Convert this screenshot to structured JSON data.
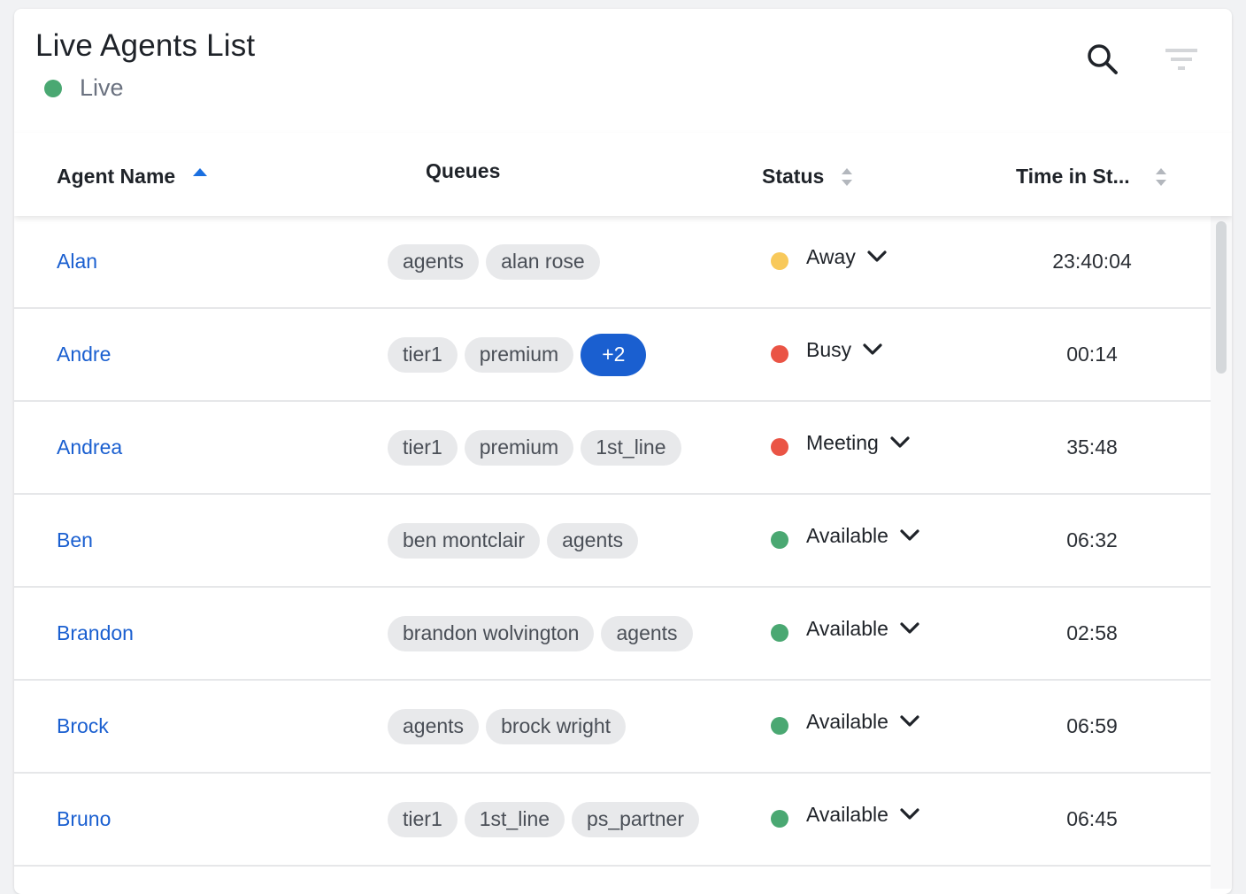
{
  "header": {
    "title": "Live Agents List",
    "live_label": "Live",
    "live_color": "#4aa872",
    "search_icon": "search-icon",
    "filter_icon": "filter-icon"
  },
  "columns": [
    {
      "label": "Agent Name",
      "sort": "ascending"
    },
    {
      "label": "Queues",
      "sort": "none"
    },
    {
      "label": "Status",
      "sort": "unsorted"
    },
    {
      "label": "Time in St...",
      "sort": "unsorted"
    }
  ],
  "colors": {
    "link": "#1a5fd0",
    "sort_active": "#1a6fe0",
    "sort_inactive": "#b3b7bd",
    "away": "#f8c95b",
    "busy": "#ea5445",
    "available": "#4aa872"
  },
  "rows": [
    {
      "name": "Alan",
      "queues": [
        "agents",
        "alan rose"
      ],
      "more": "",
      "status": "Away",
      "status_color": "#f8c95b",
      "time": "23:40:04"
    },
    {
      "name": "Andre",
      "queues": [
        "tier1",
        "premium"
      ],
      "more": "+2",
      "status": "Busy",
      "status_color": "#ea5445",
      "time": "00:14"
    },
    {
      "name": "Andrea",
      "queues": [
        "tier1",
        "premium",
        "1st_line"
      ],
      "more": "",
      "status": "Meeting",
      "status_color": "#ea5445",
      "time": "35:48"
    },
    {
      "name": "Ben",
      "queues": [
        "ben montclair",
        "agents"
      ],
      "more": "",
      "status": "Available",
      "status_color": "#4aa872",
      "time": "06:32"
    },
    {
      "name": "Brandon",
      "queues": [
        "brandon wolvington",
        "agents"
      ],
      "more": "",
      "status": "Available",
      "status_color": "#4aa872",
      "time": "02:58"
    },
    {
      "name": "Brock",
      "queues": [
        "agents",
        "brock wright"
      ],
      "more": "",
      "status": "Available",
      "status_color": "#4aa872",
      "time": "06:59"
    },
    {
      "name": "Bruno",
      "queues": [
        "tier1",
        "1st_line",
        "ps_partner"
      ],
      "more": "",
      "status": "Available",
      "status_color": "#4aa872",
      "time": "06:45"
    }
  ]
}
